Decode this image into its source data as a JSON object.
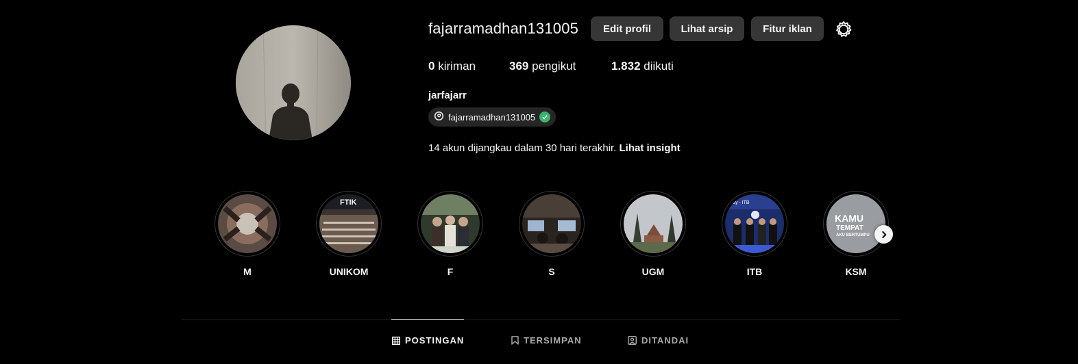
{
  "profile": {
    "username": "fajarramadhan131005",
    "full_name": "jarfajarr",
    "threads_handle": "fajarramadhan131005",
    "avatar_icon": "profile-photo"
  },
  "actions": {
    "edit_profile": "Edit profil",
    "view_archive": "Lihat arsip",
    "ad_tools": "Fitur iklan",
    "settings_icon": "gear-icon"
  },
  "stats": {
    "posts_count": "0",
    "posts_label": "kiriman",
    "followers_count": "369",
    "followers_label": "pengikut",
    "following_count": "1.832",
    "following_label": "diikuti"
  },
  "insight": {
    "text": "14 akun dijangkau dalam 30 hari terakhir.",
    "link": "Lihat insight"
  },
  "highlights": [
    {
      "label": "M"
    },
    {
      "label": "UNIKOM"
    },
    {
      "label": "F"
    },
    {
      "label": "S"
    },
    {
      "label": "UGM"
    },
    {
      "label": "ITB"
    },
    {
      "label": "KSM"
    }
  ],
  "highlight_texts": {
    "unikom_banner": "FTIK",
    "itb_banner": "Day - ITB",
    "ksm_line1": "KAMU",
    "ksm_line2": "TEMPAT",
    "ksm_line3": "AKU BERTUMPU"
  },
  "tabs": {
    "posts": "POSTINGAN",
    "saved": "TERSIMPAN",
    "tagged": "DITANDAI",
    "active": "posts"
  },
  "colors": {
    "background": "#000000",
    "button": "#363636",
    "chip": "#262626",
    "verified": "#3cb46e",
    "inactive_tab": "#a8a8a8"
  }
}
